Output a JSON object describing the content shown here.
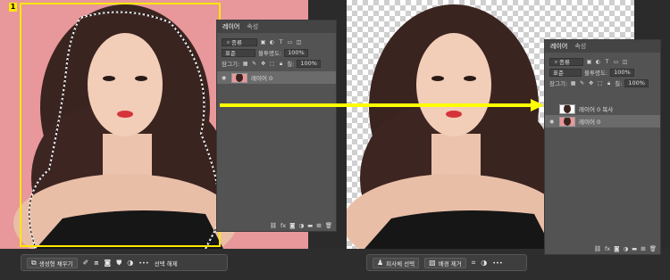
{
  "step_badge": "1",
  "colors": {
    "selection": "#ffe800",
    "arrow": "#ffff00",
    "canvas_bg": "#e8979a"
  },
  "left_panel": {
    "tabs": [
      "레이어",
      "속성"
    ],
    "filter": "종류",
    "blend_mode": "표준",
    "opacity_label": "불투명도:",
    "opacity_value": "100%",
    "lock_label": "잠그기:",
    "fill_label": "칠:",
    "fill_value": "100%",
    "layers": [
      {
        "name": "레이어 0",
        "selected": true
      }
    ],
    "footer_icons": [
      "link-icon",
      "fx-icon",
      "mask-icon",
      "adjustment-icon",
      "folder-icon",
      "new-layer-icon",
      "trash-icon"
    ]
  },
  "right_panel": {
    "tabs": [
      "레이어",
      "속성"
    ],
    "filter": "종류",
    "blend_mode": "표준",
    "opacity_label": "불투명도:",
    "opacity_value": "100%",
    "lock_label": "잠그기:",
    "fill_label": "칠:",
    "fill_value": "100%",
    "layers": [
      {
        "name": "레이어 0 복사",
        "selected": false
      },
      {
        "name": "레이어 0",
        "selected": true
      }
    ]
  },
  "left_toolbar": {
    "generative_fill": "생성형 채우기",
    "deselect": "선택 해제",
    "more": "•••"
  },
  "right_toolbar": {
    "select_subject": "피사체 선택",
    "remove_background": "배경 제거",
    "more": "•••"
  }
}
